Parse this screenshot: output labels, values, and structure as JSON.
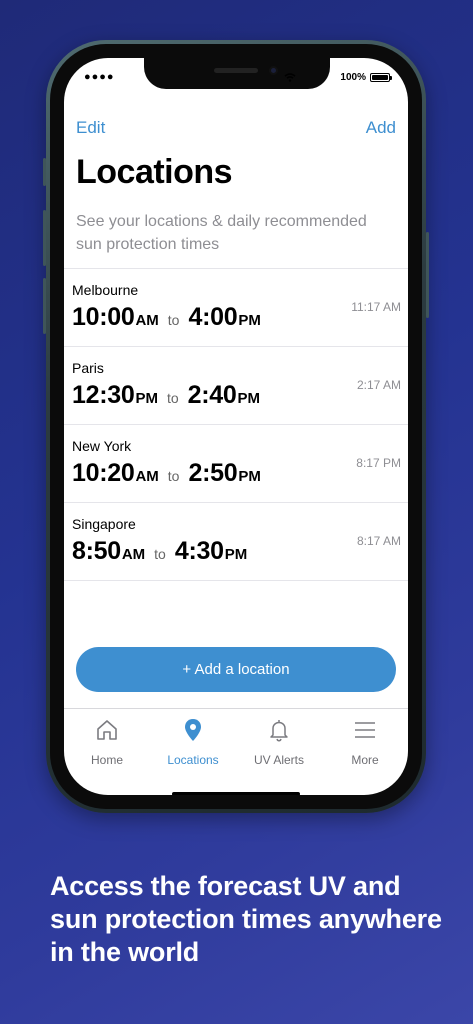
{
  "status_bar": {
    "signal": "●●●●",
    "battery": "100%"
  },
  "nav": {
    "edit_label": "Edit",
    "add_label": "Add"
  },
  "page": {
    "title": "Locations",
    "subtitle": "See your locations & daily recommended sun protection times"
  },
  "locations": [
    {
      "city": "Melbourne",
      "from_time": "10:00",
      "from_ampm": "AM",
      "to": "to",
      "to_time": "4:00",
      "to_ampm": "PM",
      "local_time": "11:17 AM"
    },
    {
      "city": "Paris",
      "from_time": "12:30",
      "from_ampm": "PM",
      "to": "to",
      "to_time": "2:40",
      "to_ampm": "PM",
      "local_time": "2:17 AM"
    },
    {
      "city": "New York",
      "from_time": "10:20",
      "from_ampm": "AM",
      "to": "to",
      "to_time": "2:50",
      "to_ampm": "PM",
      "local_time": "8:17 PM"
    },
    {
      "city": "Singapore",
      "from_time": "8:50",
      "from_ampm": "AM",
      "to": "to",
      "to_time": "4:30",
      "to_ampm": "PM",
      "local_time": "8:17 AM"
    }
  ],
  "add_location_button": "+ Add a location",
  "tabbar": {
    "tabs": [
      {
        "label": "Home",
        "icon": "home-icon",
        "active": false
      },
      {
        "label": "Locations",
        "icon": "location-pin-icon",
        "active": true
      },
      {
        "label": "UV Alerts",
        "icon": "bell-icon",
        "active": false
      },
      {
        "label": "More",
        "icon": "menu-icon",
        "active": false
      }
    ]
  },
  "headline": "Access the forecast UV and sun protection times anywhere in the world",
  "colors": {
    "accent": "#3e8fd0",
    "background": "#26338f",
    "tab_inactive": "#6e6e73"
  }
}
